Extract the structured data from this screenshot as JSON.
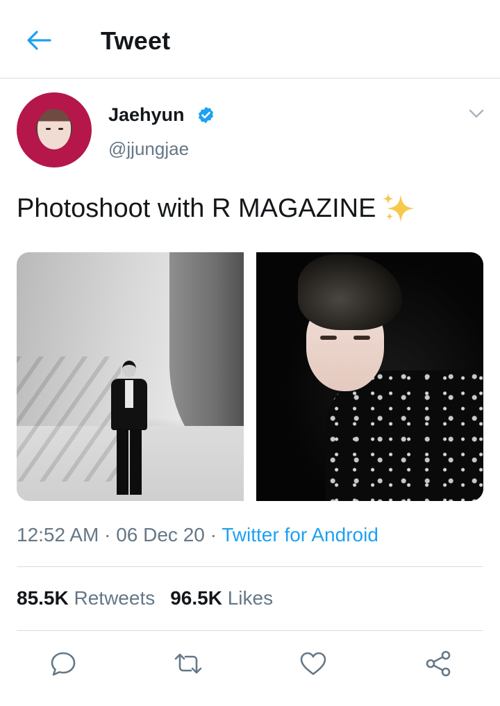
{
  "header": {
    "title": "Tweet",
    "back_icon": "arrow-left-icon"
  },
  "author": {
    "name": "Jaehyun",
    "handle": "@jjungjae",
    "verified_icon": "verified-badge-icon",
    "more_icon": "chevron-down-icon"
  },
  "tweet": {
    "text": "Photoshoot with R MAGAZINE",
    "emoji_icon": "sparkles-icon",
    "photos": [
      "photo-studio-full-body",
      "photo-close-up-portrait"
    ]
  },
  "meta": {
    "time": "12:52 AM",
    "separator": "·",
    "date": "06 Dec 20",
    "source": "Twitter for Android"
  },
  "stats": {
    "retweets_count": "85.5K",
    "retweets_label": "Retweets",
    "likes_count": "96.5K",
    "likes_label": "Likes"
  },
  "actions": [
    "reply-icon",
    "retweet-icon",
    "like-icon",
    "share-icon"
  ],
  "colors": {
    "accent": "#1da1f2",
    "text": "#14171a",
    "secondary": "#657786",
    "divider": "#d8dde1"
  }
}
